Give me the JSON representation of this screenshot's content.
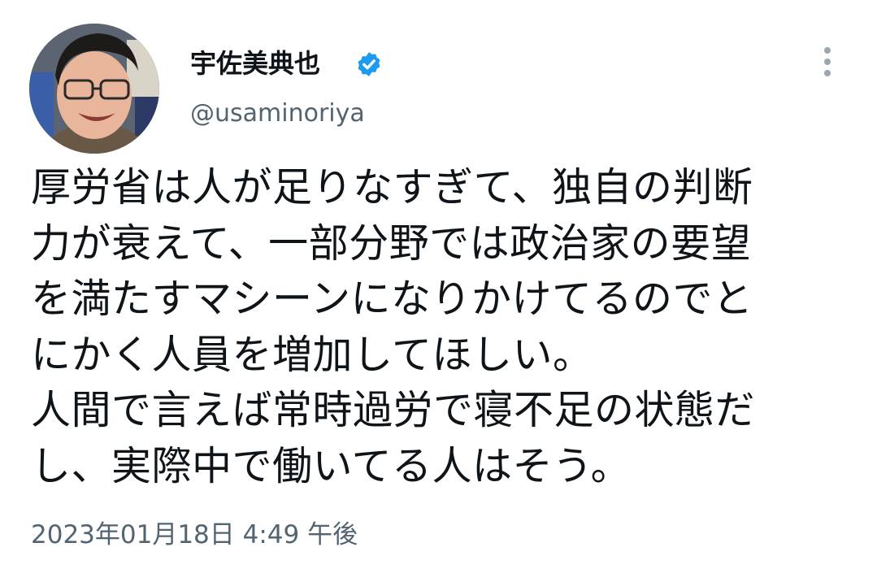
{
  "author": {
    "name": "宇佐美典也",
    "handle": "@usaminoriya",
    "verified": true,
    "avatar_icon": "profile-photo"
  },
  "menu": {
    "icon": "more-vertical-icon"
  },
  "tweet": {
    "lines": [
      "厚労省は人が足りなすぎて、独自の判断",
      "力が衰えて、一部分野では政治家の要望",
      "を満たすマシーンになりかけてるのでと",
      "にかく人員を増加してほしい。",
      "人間で言えば常時過労で寝不足の状態だ",
      "し、実際中で働いてる人はそう。"
    ],
    "timestamp": "2023年01月18日 4:49 午後"
  },
  "colors": {
    "text": "#0f1419",
    "secondary": "#536471",
    "verified": "#1d9bf0",
    "menu_dots": "#9aa6b1"
  }
}
